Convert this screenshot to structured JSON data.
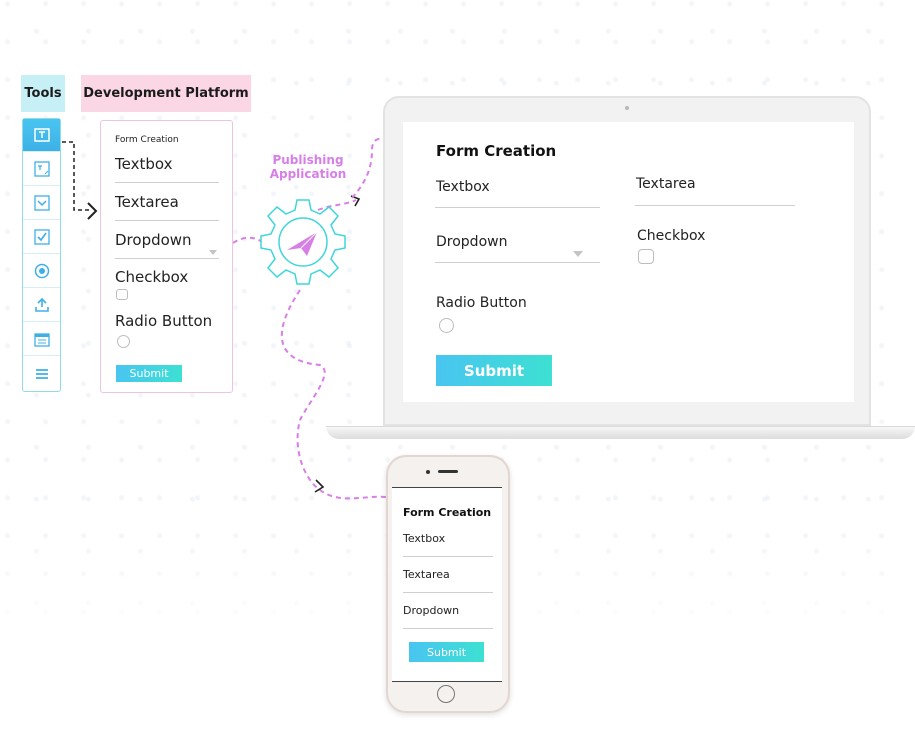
{
  "tools": {
    "label": "Tools",
    "items": [
      "textbox-tool-icon",
      "textarea-tool-icon",
      "dropdown-tool-icon",
      "checkbox-tool-icon",
      "radio-tool-icon",
      "upload-tool-icon",
      "calendar-tool-icon",
      "menu-tool-icon"
    ],
    "active_color": "#49c5f1"
  },
  "dev": {
    "label": "Development Platform",
    "title": "Form Creation",
    "textbox": "Textbox",
    "textarea": "Textarea",
    "dropdown": "Dropdown",
    "checkbox": "Checkbox",
    "radio": "Radio Button",
    "submit": "Submit"
  },
  "publishing": {
    "line1": "Publishing",
    "line2": "Application",
    "color": "#d77fe7"
  },
  "laptop": {
    "title": "Form Creation",
    "textbox": "Textbox",
    "textarea": "Textarea",
    "dropdown": "Dropdown",
    "checkbox": "Checkbox",
    "radio": "Radio Button",
    "submit": "Submit"
  },
  "phone": {
    "title": "Form Creation",
    "textbox": "Textbox",
    "textarea": "Textarea",
    "dropdown": "Dropdown",
    "submit": "Submit"
  }
}
